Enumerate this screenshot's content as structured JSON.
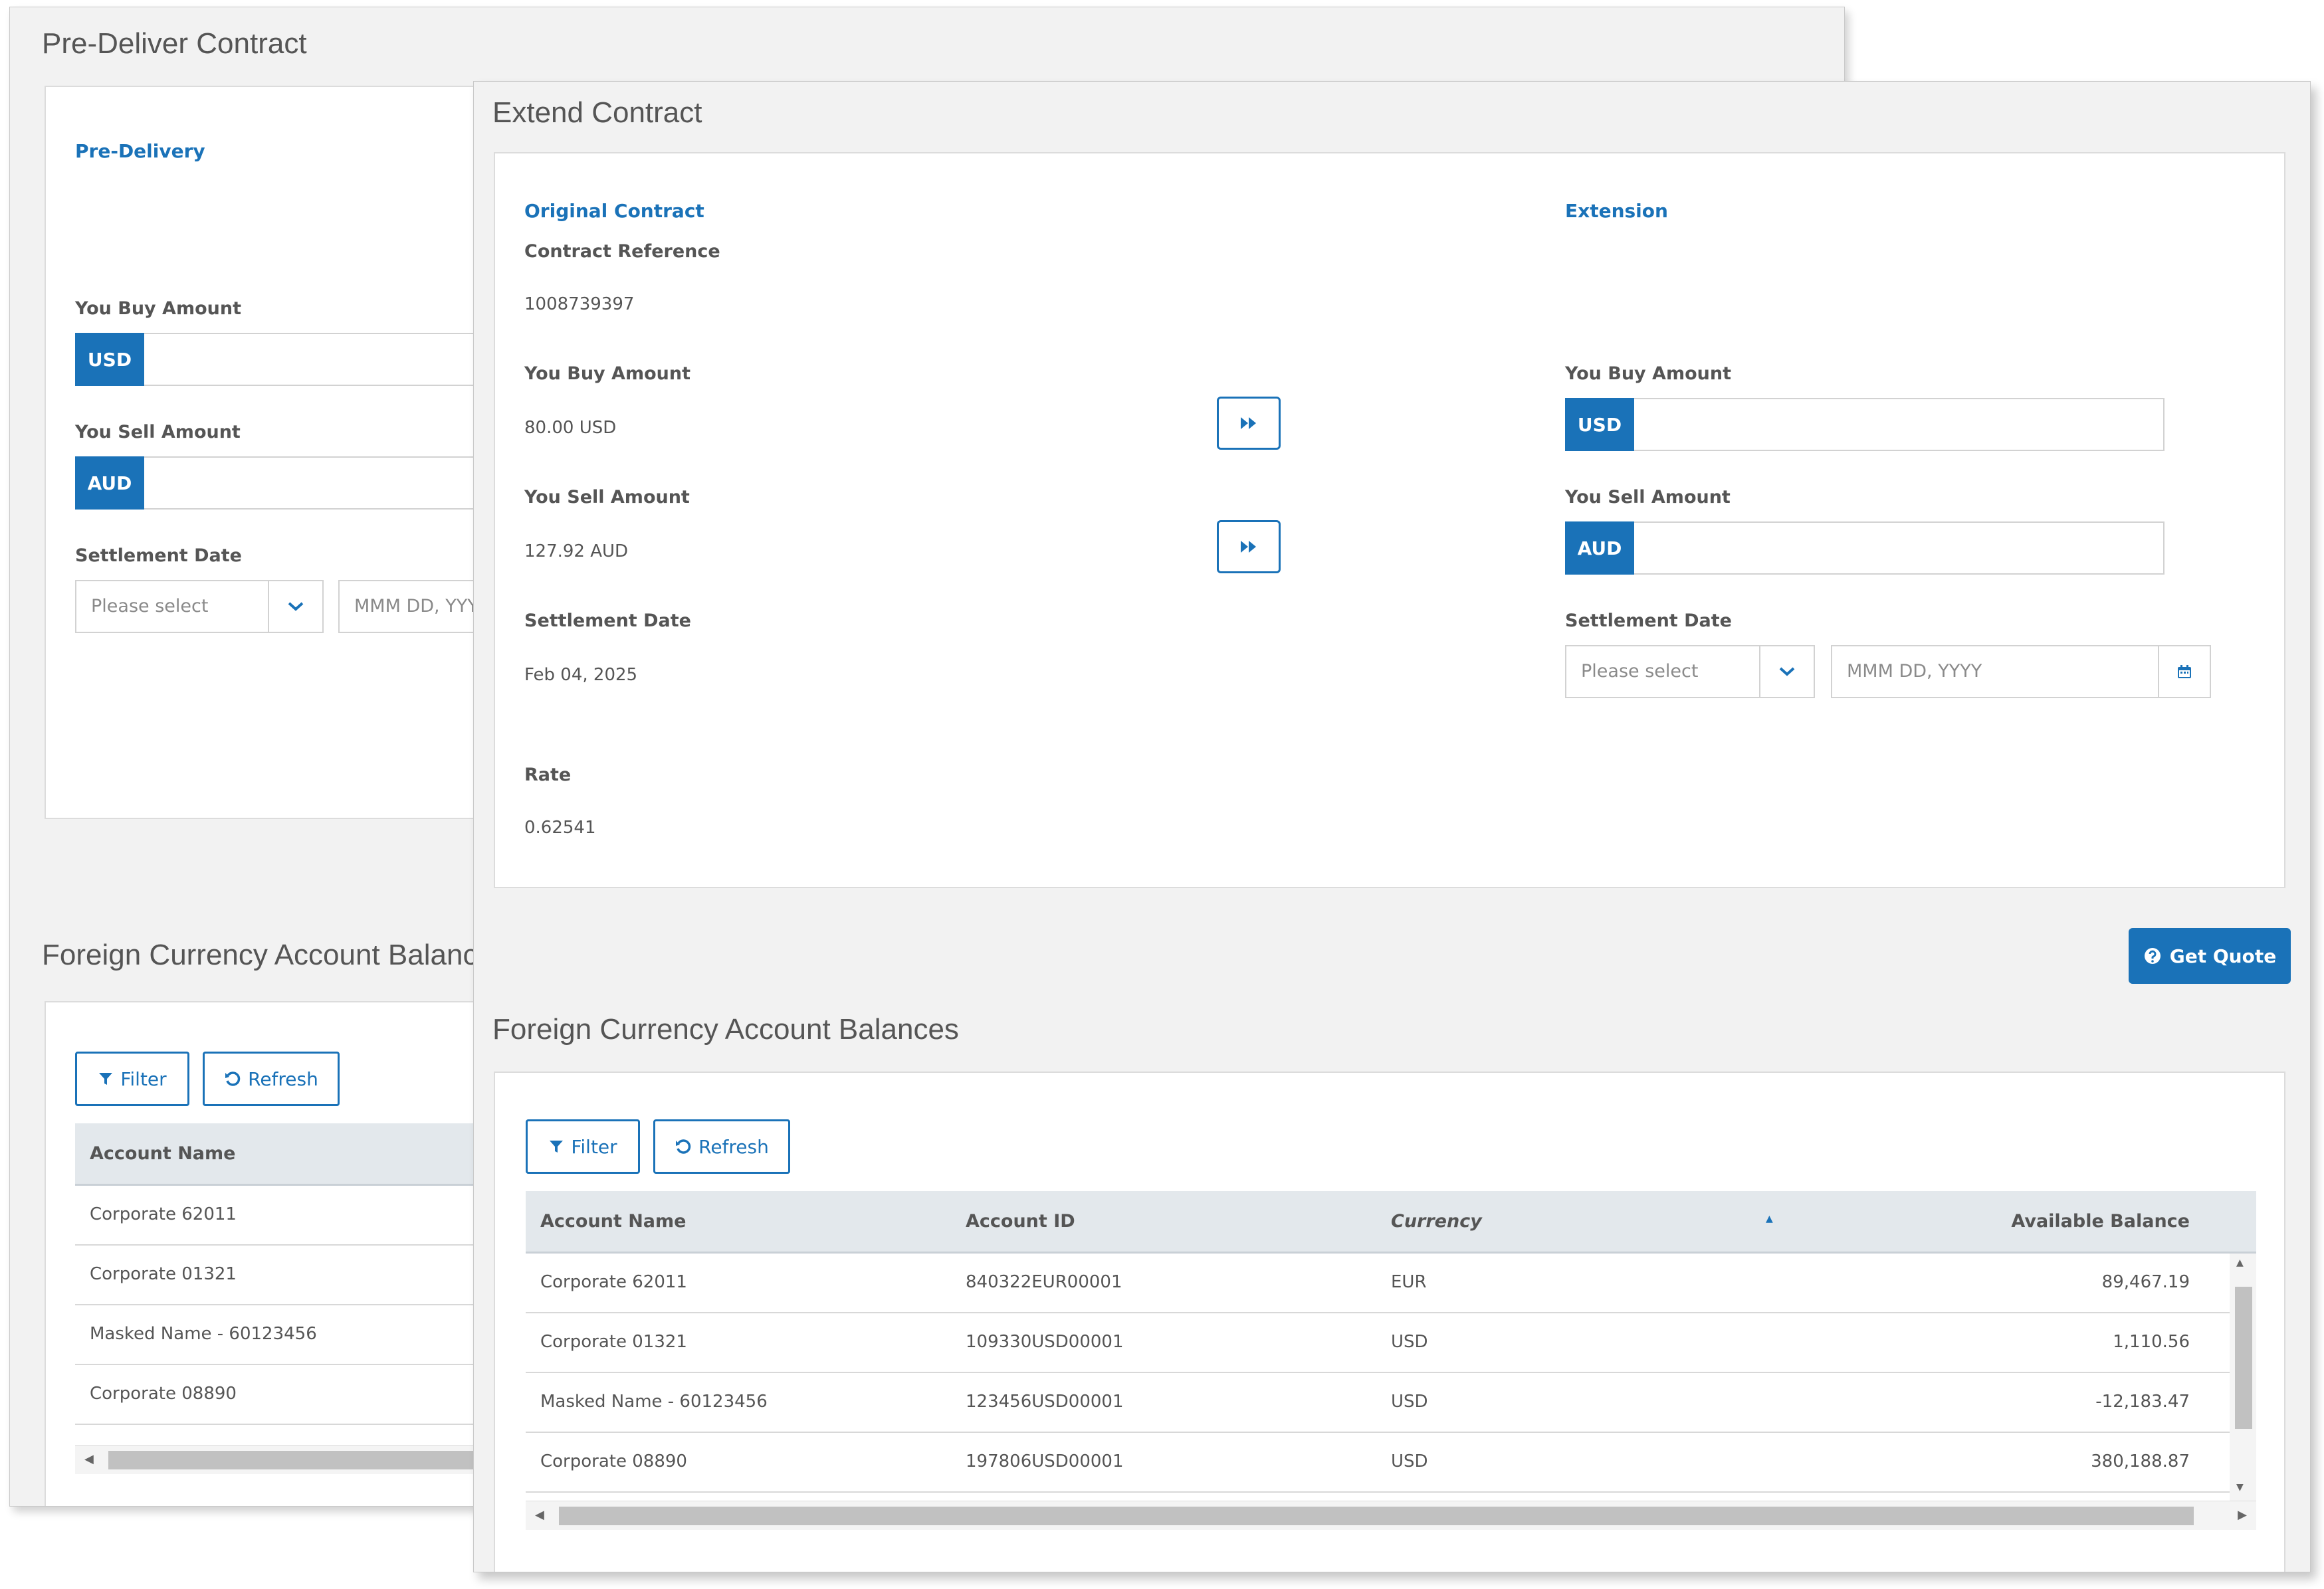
{
  "pre_deliver": {
    "title": "Pre-Deliver Contract",
    "section": "Pre-Delivery",
    "buy_label": "You Buy Amount",
    "buy_currency": "USD",
    "sell_label": "You Sell Amount",
    "sell_currency": "AUD",
    "settlement_label": "Settlement Date",
    "select_placeholder": "Please select",
    "date_placeholder": "MMM DD, YYYY",
    "balances_title": "Foreign Currency Account Balances",
    "filter_label": "Filter",
    "refresh_label": "Refresh",
    "column_account_name": "Account Name",
    "rows": [
      {
        "name": "Corporate 62011"
      },
      {
        "name": "Corporate 01321"
      },
      {
        "name": "Masked Name - 60123456"
      },
      {
        "name": "Corporate 08890"
      }
    ]
  },
  "extend": {
    "title": "Extend Contract",
    "original": {
      "heading": "Original Contract",
      "ref_label": "Contract Reference",
      "ref_value": "1008739397",
      "buy_label": "You Buy Amount",
      "buy_value": "80.00 USD",
      "sell_label": "You Sell Amount",
      "sell_value": "127.92 AUD",
      "settlement_label": "Settlement Date",
      "settlement_value": "Feb 04, 2025",
      "rate_label": "Rate",
      "rate_value": "0.62541"
    },
    "extension": {
      "heading": "Extension",
      "buy_label": "You Buy Amount",
      "buy_currency": "USD",
      "sell_label": "You Sell Amount",
      "sell_currency": "AUD",
      "settlement_label": "Settlement Date",
      "select_placeholder": "Please select",
      "date_placeholder": "MMM DD, YYYY"
    },
    "get_quote_label": "Get Quote",
    "balances": {
      "title": "Foreign Currency Account Balances",
      "filter_label": "Filter",
      "refresh_label": "Refresh",
      "columns": {
        "account_name": "Account Name",
        "account_id": "Account ID",
        "currency": "Currency",
        "available_balance": "Available Balance"
      },
      "rows": [
        {
          "name": "Corporate 62011",
          "id": "840322EUR00001",
          "currency": "EUR",
          "balance": "89,467.19"
        },
        {
          "name": "Corporate 01321",
          "id": "109330USD00001",
          "currency": "USD",
          "balance": "1,110.56"
        },
        {
          "name": "Masked Name - 60123456",
          "id": "123456USD00001",
          "currency": "USD",
          "balance": "-12,183.47"
        },
        {
          "name": "Corporate 08890",
          "id": "197806USD00001",
          "currency": "USD",
          "balance": "380,188.87"
        }
      ]
    }
  },
  "colors": {
    "accent": "#1a72b8",
    "panel": "#f2f2f2",
    "table_header": "#e3e8ec"
  },
  "icons": [
    "chevron-down-icon",
    "calendar-icon",
    "fast-forward-icon",
    "filter-icon",
    "refresh-icon",
    "help-circle-icon"
  ]
}
